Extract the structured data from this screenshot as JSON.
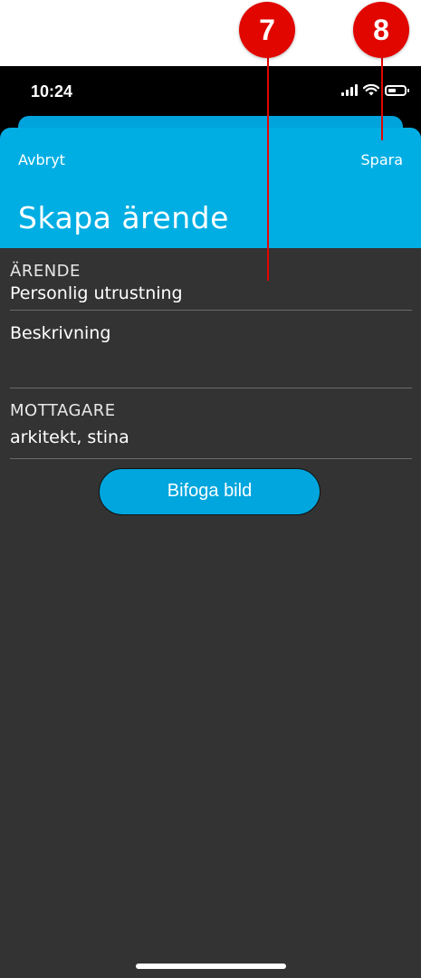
{
  "status_bar": {
    "time": "10:24"
  },
  "nav": {
    "cancel_label": "Avbryt",
    "save_label": "Spara"
  },
  "page": {
    "title": "Skapa ärende"
  },
  "form": {
    "case_label": "ÄRENDE",
    "case_value": "Personlig utrustning",
    "description_label": "Beskrivning",
    "recipient_label": "MOTTAGARE",
    "recipient_value": "arkitekt, stina"
  },
  "attach_button": {
    "label": "Bifoga bild"
  },
  "callouts": [
    {
      "number": "7"
    },
    {
      "number": "8"
    }
  ],
  "colors": {
    "accent": "#00aee3",
    "background": "#333333",
    "callout": "#e10600"
  }
}
